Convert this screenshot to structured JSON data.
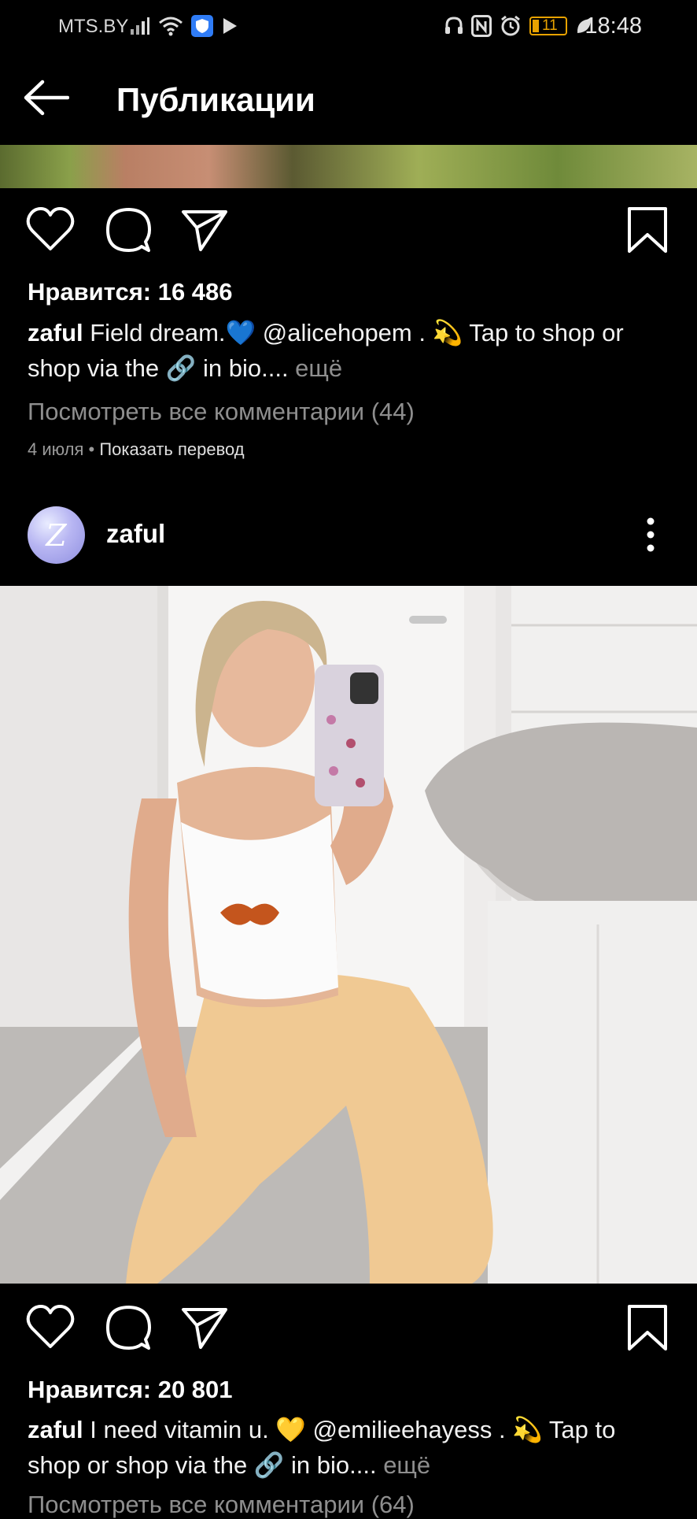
{
  "status_bar": {
    "carrier": "MTS.BY",
    "battery": "11",
    "time": "18:48"
  },
  "header": {
    "title": "Публикации"
  },
  "posts": [
    {
      "likes": "Нравится: 16 486",
      "caption_user": "zaful",
      "caption_text": " Field dream.💙 @alicehopem . 💫 Tap to shop or shop via the 🔗 in bio....",
      "caption_more": " ещё",
      "comments": "Посмотреть все комментарии (44)",
      "date": "4 июля",
      "translate": "Показать перевод"
    },
    {
      "username": "zaful",
      "avatar_letter": "Z",
      "likes": "Нравится: 20 801",
      "caption_user": "zaful",
      "caption_text": " I need vitamin u. 💛 @emilieehayess . 💫 Tap to shop or shop via the 🔗 in bio....",
      "caption_more": " ещё",
      "comments": "Посмотреть все комментарии (64)"
    }
  ],
  "icons": [
    "back-arrow-icon",
    "heart-icon",
    "comment-icon",
    "share-icon",
    "bookmark-icon",
    "more-vertical-icon"
  ],
  "colors": {
    "background": "#000000",
    "muted": "#8e8e8e",
    "text": "#ffffff"
  }
}
